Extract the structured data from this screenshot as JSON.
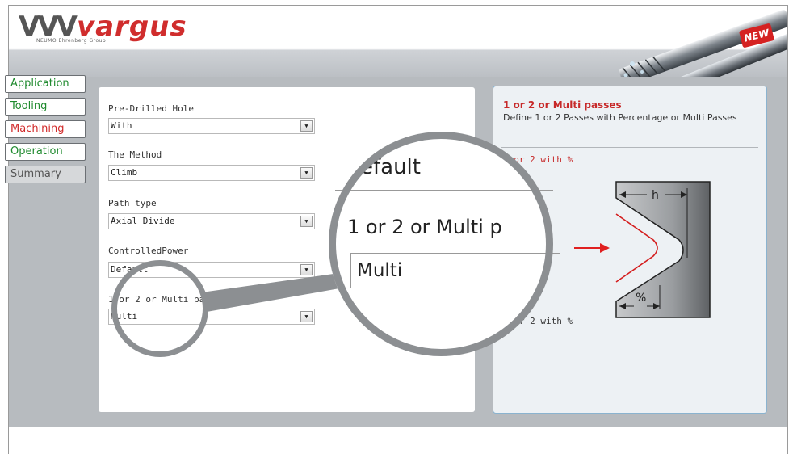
{
  "header": {
    "brand": "vargus",
    "brand_sub": "NEUMO Ehrenberg Group",
    "badge": "NEW"
  },
  "tabs": [
    {
      "label": "Application",
      "state": "done"
    },
    {
      "label": "Tooling",
      "state": "done"
    },
    {
      "label": "Machining",
      "state": "active"
    },
    {
      "label": "Operation",
      "state": "done"
    },
    {
      "label": "Summary",
      "state": "disabled"
    }
  ],
  "form": {
    "pre_drilled": {
      "label": "Pre-Drilled Hole",
      "value": "With"
    },
    "method": {
      "label": "The Method",
      "value": "Climb"
    },
    "path_type": {
      "label": "Path type",
      "value": "Axial Divide"
    },
    "controlled_power": {
      "label": "ControlledPower",
      "value": "Default"
    },
    "passes": {
      "label": "1 or 2 or Multi passes",
      "value": "Multi"
    }
  },
  "info": {
    "title": "1 or 2 or Multi passes",
    "description": "Define 1 or 2 Passes with Percentage or Multi Passes",
    "subtitle": "1 or 2 with %",
    "diagram_h": "h",
    "diagram_pct": "%",
    "caption": "1 or 2 with %"
  },
  "magnifier": {
    "line1": "efault",
    "line2": "1 or 2 or Multi p",
    "line3": "Multi"
  },
  "colors": {
    "accent_red": "#d12a2a",
    "tab_green": "#1f8a2e",
    "panel_border": "#8ab3cf"
  }
}
